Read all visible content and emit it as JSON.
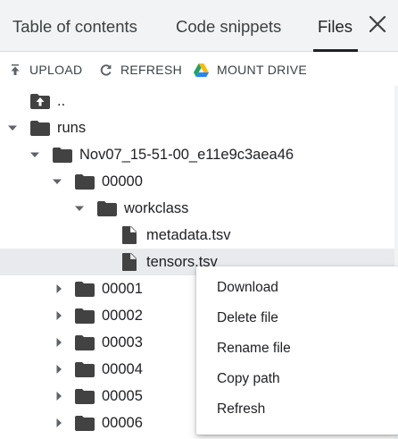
{
  "tabs": [
    {
      "label": "Table of contents"
    },
    {
      "label": "Code snippets"
    },
    {
      "label": "Files"
    }
  ],
  "toolbar": {
    "upload_label": "UPLOAD",
    "refresh_label": "REFRESH",
    "mount_label": "MOUNT DRIVE"
  },
  "tree": [
    {
      "label": "..",
      "kind": "parent-folder"
    },
    {
      "label": "runs",
      "kind": "folder",
      "state": "expanded"
    },
    {
      "label": "Nov07_15-51-00_e11e9c3aea46",
      "kind": "folder",
      "state": "expanded"
    },
    {
      "label": "00000",
      "kind": "folder",
      "state": "expanded"
    },
    {
      "label": "workclass",
      "kind": "folder",
      "state": "expanded"
    },
    {
      "label": "metadata.tsv",
      "kind": "file"
    },
    {
      "label": "tensors.tsv",
      "kind": "file",
      "selected": true
    },
    {
      "label": "00001",
      "kind": "folder",
      "state": "collapsed"
    },
    {
      "label": "00002",
      "kind": "folder",
      "state": "collapsed"
    },
    {
      "label": "00003",
      "kind": "folder",
      "state": "collapsed"
    },
    {
      "label": "00004",
      "kind": "folder",
      "state": "collapsed"
    },
    {
      "label": "00005",
      "kind": "folder",
      "state": "collapsed"
    },
    {
      "label": "00006",
      "kind": "folder",
      "state": "collapsed"
    }
  ],
  "context_menu": {
    "items": [
      {
        "label": "Download"
      },
      {
        "label": "Delete file"
      },
      {
        "label": "Rename file"
      },
      {
        "label": "Copy path"
      },
      {
        "label": "Refresh"
      }
    ]
  },
  "colors": {
    "tabbar_bg": "#f1f3f4",
    "selected_row": "#e8eaed",
    "icon_gray": "#5f6368",
    "folder_dark": "#424242",
    "drive_green": "#1ea362",
    "drive_yellow": "#ffba00",
    "drive_blue": "#2684fc"
  }
}
